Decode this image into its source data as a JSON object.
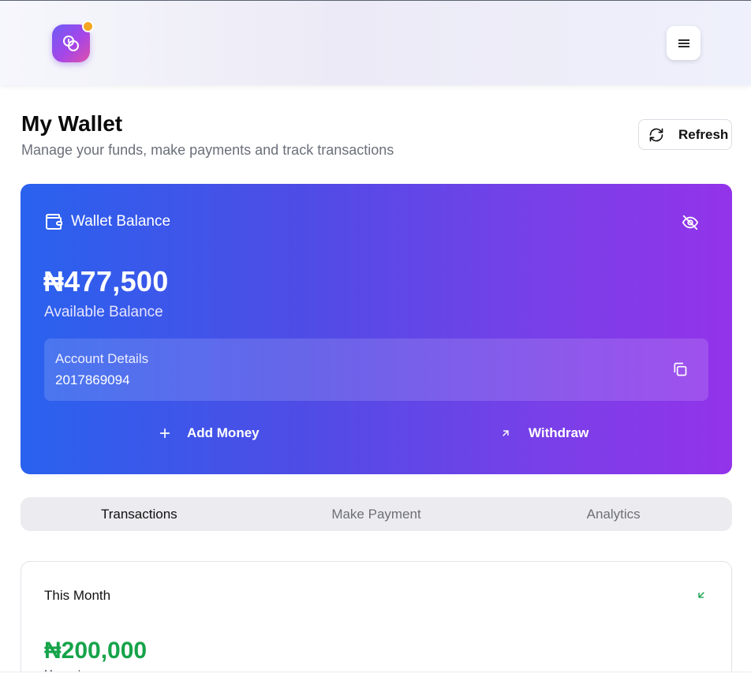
{
  "header": {
    "logo_icon": "coins-icon",
    "menu_icon": "hamburger-menu-icon"
  },
  "page": {
    "title": "My Wallet",
    "subtitle": "Manage your funds, make payments and track transactions",
    "refresh_label": "Refresh"
  },
  "wallet": {
    "label": "Wallet Balance",
    "balance": "₦477,500",
    "balance_caption": "Available Balance",
    "account_title": "Account Details",
    "account_number": "2017869094",
    "add_money_label": "Add Money",
    "withdraw_label": "Withdraw",
    "gradient_start": "#2962ee",
    "gradient_end": "#9333ea"
  },
  "tabs": [
    {
      "label": "Transactions",
      "active": true
    },
    {
      "label": "Make Payment",
      "active": false
    },
    {
      "label": "Analytics",
      "active": false
    }
  ],
  "month_card": {
    "title": "This Month",
    "value": "₦200,000",
    "caption": "Money In",
    "accent": "#16a34a"
  }
}
